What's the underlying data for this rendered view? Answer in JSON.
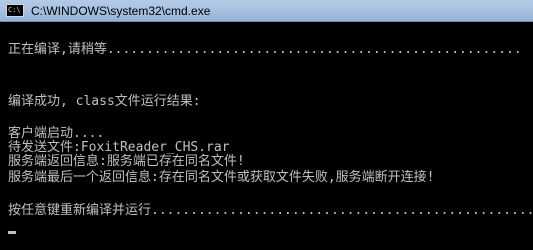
{
  "window": {
    "title": "C:\\WINDOWS\\system32\\cmd.exe",
    "icon_text": "C:\\"
  },
  "console": {
    "lines": [
      "正在编译,请稍等.....................................................",
      "编译成功, class文件运行结果:",
      "客户端启动....",
      "待发送文件:FoxitReader_CHS.rar",
      "服务端返回信息:服务端已存在同名文件!",
      "服务端最后一个返回信息:存在同名文件或获取文件失败,服务端断开连接!",
      "按任意键重新编译并运行................................................."
    ]
  }
}
